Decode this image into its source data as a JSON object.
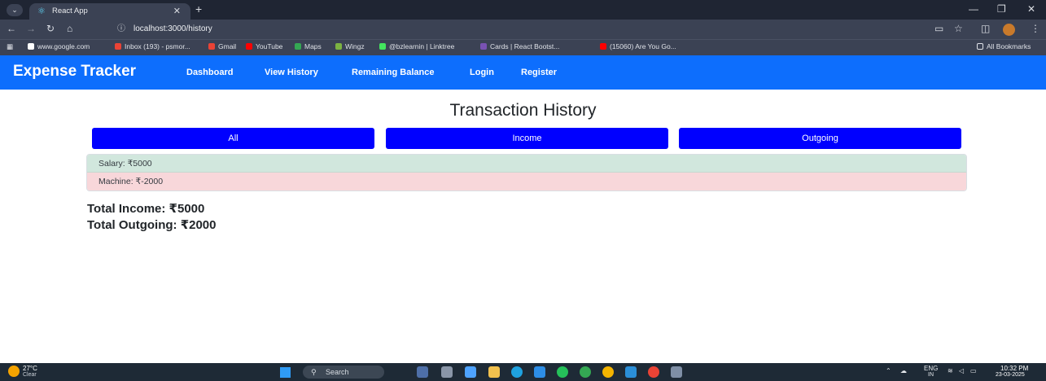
{
  "browser": {
    "tab_title": "React App",
    "url": "localhost:3000/history",
    "bookmarks": [
      "www.google.com",
      "Inbox (193) - psmor...",
      "Gmail",
      "YouTube",
      "Maps",
      "Wingz",
      "@bzlearnin | Linktree",
      "Cards | React Bootst...",
      "(15060) Are You Go..."
    ],
    "all_bookmarks": "All Bookmarks"
  },
  "app": {
    "brand": "Expense Tracker",
    "nav": [
      "Dashboard",
      "View History",
      "Remaining Balance",
      "Login",
      "Register"
    ],
    "title": "Transaction History",
    "filters": [
      "All",
      "Income",
      "Outgoing"
    ],
    "transactions": [
      {
        "label": "Salary: ₹5000",
        "type": "income"
      },
      {
        "label": "Machine: ₹-2000",
        "type": "outgoing"
      }
    ],
    "total_income": "Total Income: ₹5000",
    "total_outgoing": "Total Outgoing: ₹2000",
    "colors": {
      "navbar": "#0d6efd",
      "filter_button": "#0000ff",
      "income_row": "#d1e7dd",
      "outgoing_row": "#f8d7da"
    }
  },
  "taskbar": {
    "temperature": "27°C",
    "weather": "Clear",
    "search_placeholder": "Search",
    "language": "ENG",
    "region": "IN",
    "time": "10:32 PM",
    "date": "23-03-2025"
  }
}
